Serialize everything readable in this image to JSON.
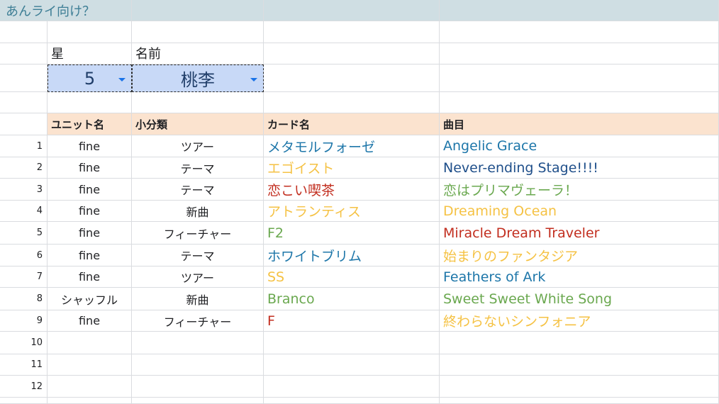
{
  "title": "あんライ向け？",
  "filters": {
    "star_label": "星",
    "name_label": "名前",
    "star_value": "5",
    "name_value": "桃李"
  },
  "table": {
    "headers": [
      "ユニット名",
      "小分類",
      "カード名",
      "曲目"
    ],
    "rows": [
      {
        "num": "1",
        "unit": "fine",
        "category": "ツアー",
        "card": "メタモルフォーゼ",
        "card_color": "blue",
        "song": "Angelic Grace",
        "song_color": "blue"
      },
      {
        "num": "2",
        "unit": "fine",
        "category": "テーマ",
        "card": "エゴイスト",
        "card_color": "orange",
        "song": "Never-ending Stage!!!!",
        "song_color": "navy"
      },
      {
        "num": "3",
        "unit": "fine",
        "category": "テーマ",
        "card": "恋こい喫茶",
        "card_color": "red",
        "song": "恋はプリマヴェーラ！",
        "song_color": "green"
      },
      {
        "num": "4",
        "unit": "fine",
        "category": "新曲",
        "card": "アトランティス",
        "card_color": "orange",
        "song": "Dreaming Ocean",
        "song_color": "orange"
      },
      {
        "num": "5",
        "unit": "fine",
        "category": "フィーチャー",
        "card": "F2",
        "card_color": "green",
        "song": "Miracle Dream Traveler",
        "song_color": "red"
      },
      {
        "num": "6",
        "unit": "fine",
        "category": "テーマ",
        "card": "ホワイトブリム",
        "card_color": "blue",
        "song": "始まりのファンタジア",
        "song_color": "orange"
      },
      {
        "num": "7",
        "unit": "fine",
        "category": "ツアー",
        "card": "SS",
        "card_color": "orange",
        "song": "Feathers of Ark",
        "song_color": "blue"
      },
      {
        "num": "8",
        "unit": "シャッフル",
        "category": "新曲",
        "card": "Branco",
        "card_color": "green",
        "song": "Sweet Sweet White Song",
        "song_color": "green"
      },
      {
        "num": "9",
        "unit": "fine",
        "category": "フィーチャー",
        "card": "F",
        "card_color": "red",
        "song": "終わらないシンフォニア",
        "song_color": "orange"
      }
    ],
    "empty_row_numbers": [
      "10",
      "11",
      "12"
    ]
  }
}
